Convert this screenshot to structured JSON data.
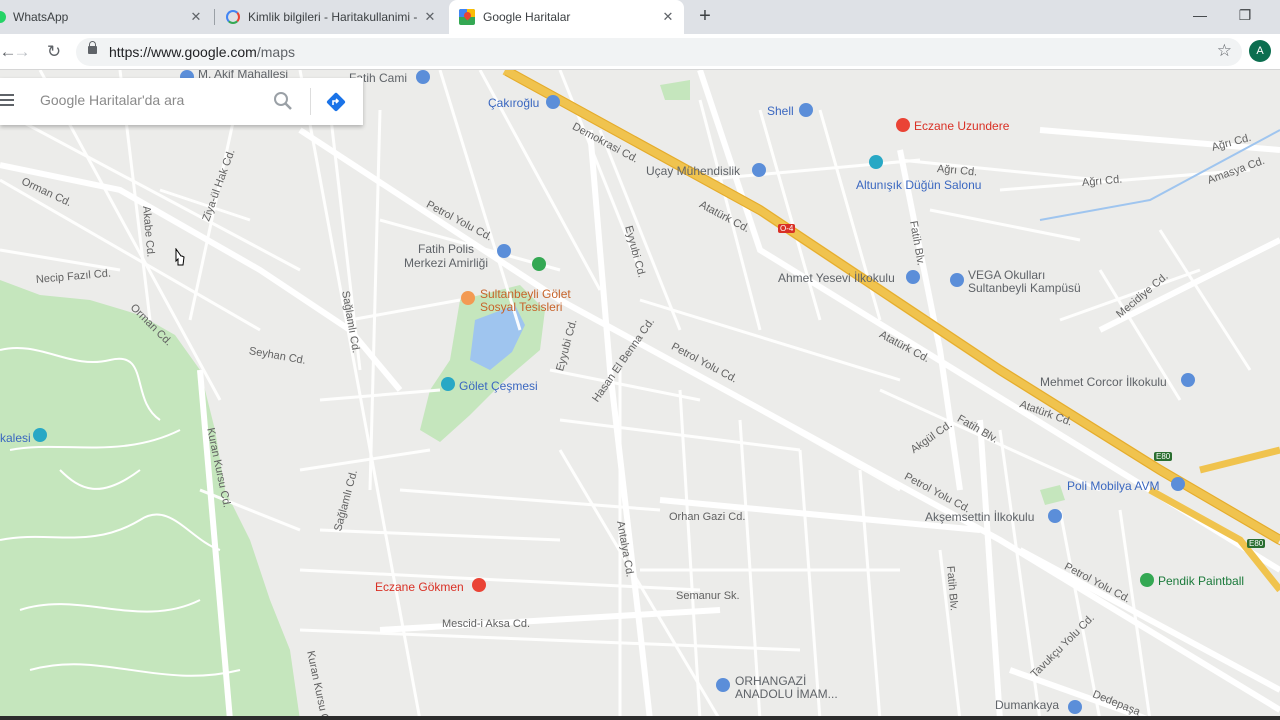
{
  "browser": {
    "tabs": [
      {
        "title": "WhatsApp",
        "active": false
      },
      {
        "title": "Kimlik bilgileri - Haritakullanimi -",
        "active": false
      },
      {
        "title": "Google Haritalar",
        "active": true
      }
    ],
    "new_tab": "+",
    "url_host": "https://www.google.com",
    "url_path": "/maps",
    "profile_initial": "A",
    "window_minimize": "—",
    "window_restore": "❐"
  },
  "search": {
    "placeholder": "Google Haritalar'da ara"
  },
  "places": [
    {
      "name": "Eczane Uzundere",
      "kind": "pharmacy",
      "color": "red"
    },
    {
      "name": "Shell",
      "kind": "gas",
      "color": "blue"
    },
    {
      "name": "Çakıroğlu",
      "kind": "place",
      "color": "blue"
    },
    {
      "name": "Fatih Cami",
      "kind": "mosque",
      "color": "gray"
    },
    {
      "name": "M. Akif Mahallesi",
      "kind": "place",
      "color": "gray"
    },
    {
      "name": "Uçay Mühendislik",
      "kind": "business",
      "color": "gray"
    },
    {
      "name": "Altunışık Düğün Salonu",
      "kind": "venue",
      "color": "teal"
    },
    {
      "name": "Fatih Polis Merkezi Amirliği",
      "kind": "police",
      "color": "gray"
    },
    {
      "name": "Sultanbeyli Gölet Sosyal Tesisleri",
      "kind": "restaurant",
      "color": "orange"
    },
    {
      "name": "Ahmet Yesevi İlkokulu",
      "kind": "school",
      "color": "gray"
    },
    {
      "name": "VEGA Okulları Sultanbeyli Kampüsü",
      "kind": "school",
      "color": "gray"
    },
    {
      "name": "Gölet Çeşmesi",
      "kind": "landmark",
      "color": "teal"
    },
    {
      "name": "Mehmet Corcor İlkokulu",
      "kind": "school",
      "color": "gray"
    },
    {
      "name": "Poli Mobilya AVM",
      "kind": "shop",
      "color": "blue"
    },
    {
      "name": "Akşemsettin İlkokulu",
      "kind": "school",
      "color": "gray"
    },
    {
      "name": "Pendik Paintball",
      "kind": "activity",
      "color": "green"
    },
    {
      "name": "Eczane Gökmen",
      "kind": "pharmacy",
      "color": "red"
    },
    {
      "name": "ORHANGAZİ ANADOLU İMAM...",
      "kind": "school",
      "color": "gray"
    },
    {
      "name": "Dumankaya",
      "kind": "place",
      "color": "gray"
    },
    {
      "name": "kalesi",
      "kind": "landmark",
      "color": "teal"
    }
  ],
  "streets": [
    "Demokrasi Cd.",
    "Petrol Yolu Cd.",
    "Atatürk Cd.",
    "Ağrı Cd.",
    "Amasya Cd.",
    "Fatih Blv.",
    "Mecidiye Cd.",
    "Eyyubi Cd.",
    "Hasan El Benna Cd.",
    "Orhan Gazi Cd.",
    "Semanur Sk.",
    "Mescid-i Aksa Cd.",
    "Kuran Kursu Cd.",
    "Antalya Cd.",
    "Akgül Cd.",
    "Tavukçu Yolu Cd.",
    "Seyhan Cd.",
    "Sağlamlı Cd.",
    "Orman Cd.",
    "Akabe Cd.",
    "Ziya-ül Hak Cd.",
    "Necip Fazıl Cd.",
    "Dedepaşa"
  ],
  "highway_badges": [
    "O-4",
    "E80",
    "E80"
  ]
}
